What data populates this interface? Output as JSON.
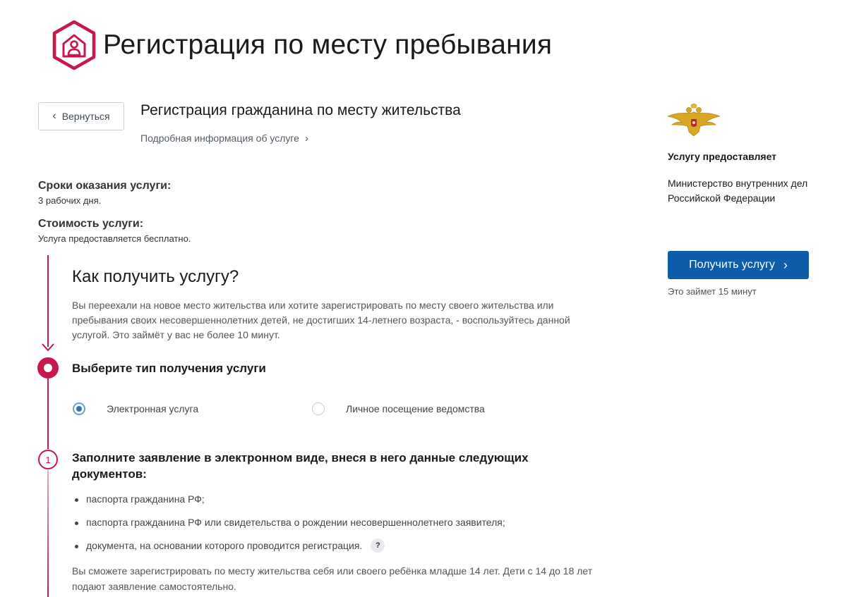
{
  "header": {
    "title": "Регистрация по месту пребывания",
    "logo_icon": "house-person-icon",
    "brand_color": "#c7174b"
  },
  "back_button": {
    "label": "Вернуться",
    "icon": "chevron-left-icon"
  },
  "service": {
    "title": "Регистрация гражданина по месту жительства",
    "info_link": "Подробная информация об услуге",
    "terms_label": "Сроки оказания услуги:",
    "terms_value": "3 рабочих дня.",
    "cost_label": "Стоимость услуги:",
    "cost_value": "Услуга предоставляется бесплатно."
  },
  "how": {
    "title": "Как получить услугу?",
    "text": "Вы переехали на новое место жительства или хотите зарегистрировать по месту своего жительства или пребывания своих несовершеннолетних детей, не достигших 14-летнего возраста, - воспользуйтесь данной услугой. Это займёт у вас не более 10 минут."
  },
  "step_type": {
    "title": "Выберите тип получения услуги",
    "options": [
      {
        "label": "Электронная услуга",
        "selected": true
      },
      {
        "label": "Личное посещение ведомства",
        "selected": false
      }
    ]
  },
  "step_fill": {
    "number": "1",
    "title": "Заполните заявление в электронном виде, внеся в него данные следующих документов:",
    "documents": [
      "паспорта гражданина РФ;",
      "паспорта гражданина РФ или свидетельства о рождении несовершеннолетнего заявителя;",
      "документа, на основании которого проводится регистрация."
    ],
    "help_mark": "?",
    "note": "Вы сможете зарегистрировать по месту жительства себя или своего ребёнка младше 14 лет. Дети с 14 до 18 лет подают заявление самостоятельно."
  },
  "provider": {
    "emblem_icon": "double-headed-eagle-emblem-icon",
    "heading": "Услугу предоставляет",
    "name": "Министерство внутренних дел Российской Федерации"
  },
  "cta": {
    "label": "Получить услугу",
    "time_note": "Это займет 15 минут",
    "color": "#0d5dab"
  }
}
